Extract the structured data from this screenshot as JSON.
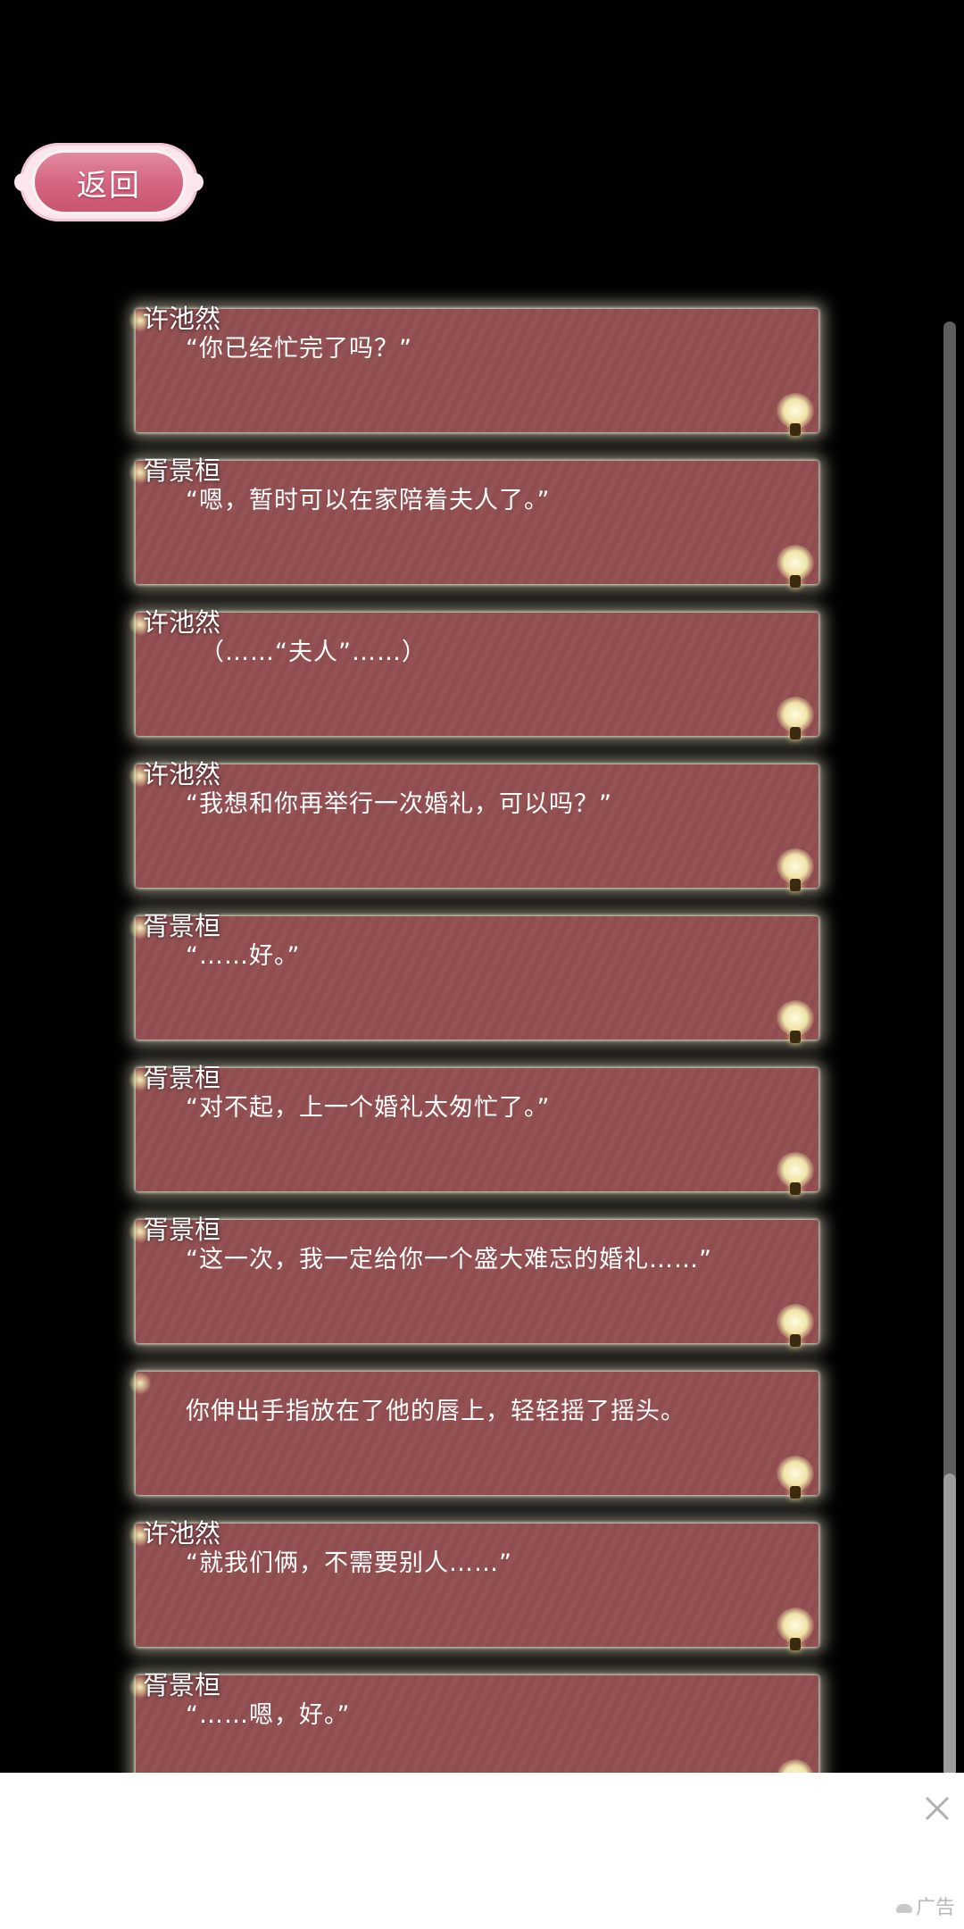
{
  "back_button": {
    "label": "返回"
  },
  "log": [
    {
      "speaker": "许池然",
      "text": "“你已经忙完了吗？”"
    },
    {
      "speaker": "胥景桓",
      "text": "“嗯，暂时可以在家陪着夫人了。”"
    },
    {
      "speaker": "许池然",
      "text": "（……“夫人”……）"
    },
    {
      "speaker": "许池然",
      "text": "“我想和你再举行一次婚礼，可以吗？”"
    },
    {
      "speaker": "胥景桓",
      "text": "“……好。”"
    },
    {
      "speaker": "胥景桓",
      "text": "“对不起，上一个婚礼太匆忙了。”"
    },
    {
      "speaker": "胥景桓",
      "text": "“这一次，我一定给你一个盛大难忘的婚礼……”"
    },
    {
      "speaker": "",
      "text": "你伸出手指放在了他的唇上，轻轻摇了摇头。"
    },
    {
      "speaker": "许池然",
      "text": "“就我们俩，不需要别人……”"
    },
    {
      "speaker": "胥景桓",
      "text": "“……嗯，好。”"
    }
  ],
  "ad": {
    "label": "广告"
  },
  "colors": {
    "card": "#955254",
    "accent_pink": "#d4637f",
    "background": "#000000"
  }
}
